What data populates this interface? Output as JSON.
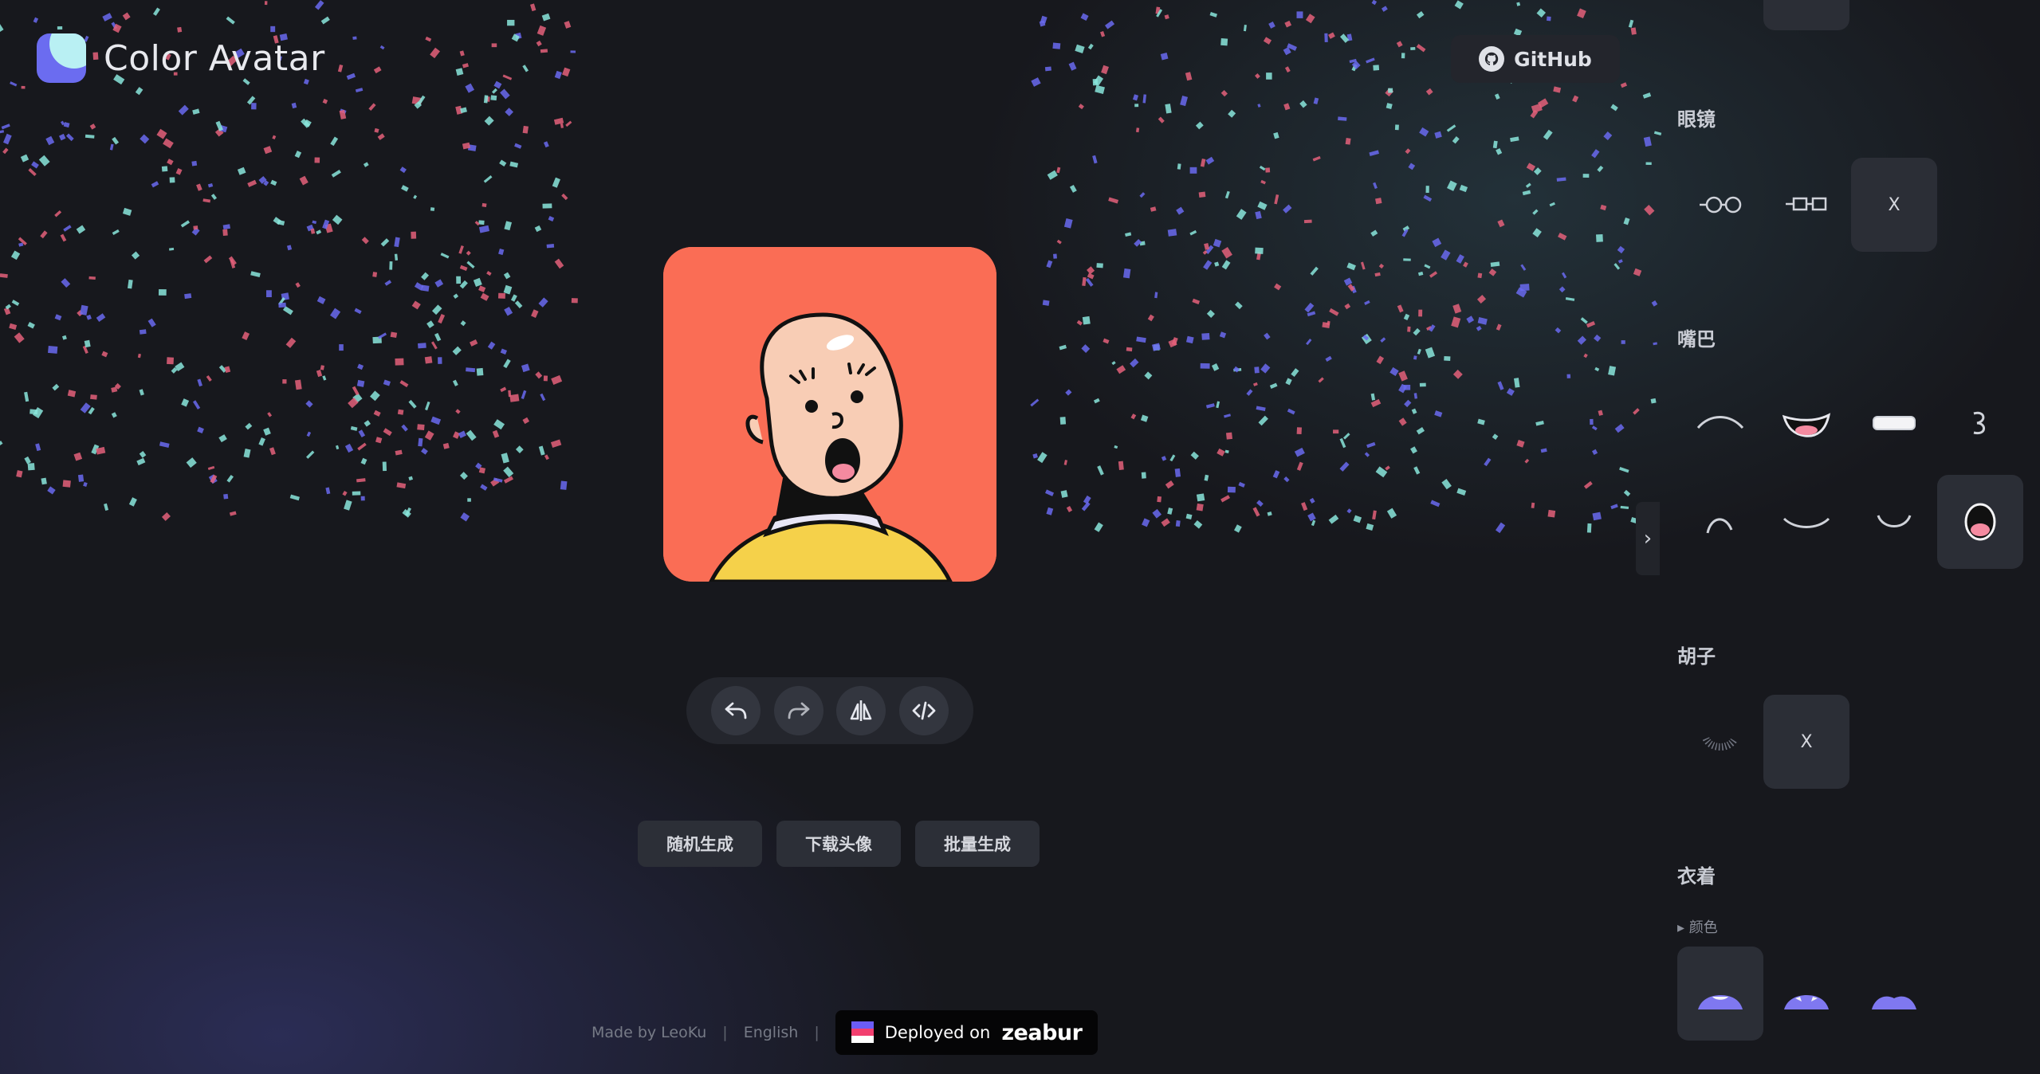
{
  "app": {
    "title": "Color Avatar"
  },
  "header": {
    "github_label": "GitHub"
  },
  "toolbar": {
    "buttons": [
      {
        "name": "undo",
        "icon": "undo-icon"
      },
      {
        "name": "redo",
        "icon": "redo-icon"
      },
      {
        "name": "flip",
        "icon": "flip-icon"
      },
      {
        "name": "code",
        "icon": "code-icon"
      }
    ]
  },
  "actions": {
    "random": "随机生成",
    "download": "下载头像",
    "batch": "批量生成"
  },
  "footer": {
    "made_by": "Made by LeoKu",
    "language": "English",
    "deployed_on": "Deployed on",
    "brand": "zeabur"
  },
  "panel": {
    "glasses": {
      "title": "眼镜",
      "none_label": "X"
    },
    "mouth": {
      "title": "嘴巴",
      "selected_index": 7
    },
    "beard": {
      "title": "胡子",
      "none_label": "X"
    },
    "clothes": {
      "title": "衣着",
      "color_toggle": "▸ 颜色"
    },
    "collapse_icon": "›"
  },
  "colors": {
    "avatar_bg": "#fa6d55",
    "skin": "#f8cdb5",
    "shirt": "#f5d14a",
    "collar": "#e8e6f5",
    "accent": "#6b6cf0"
  }
}
